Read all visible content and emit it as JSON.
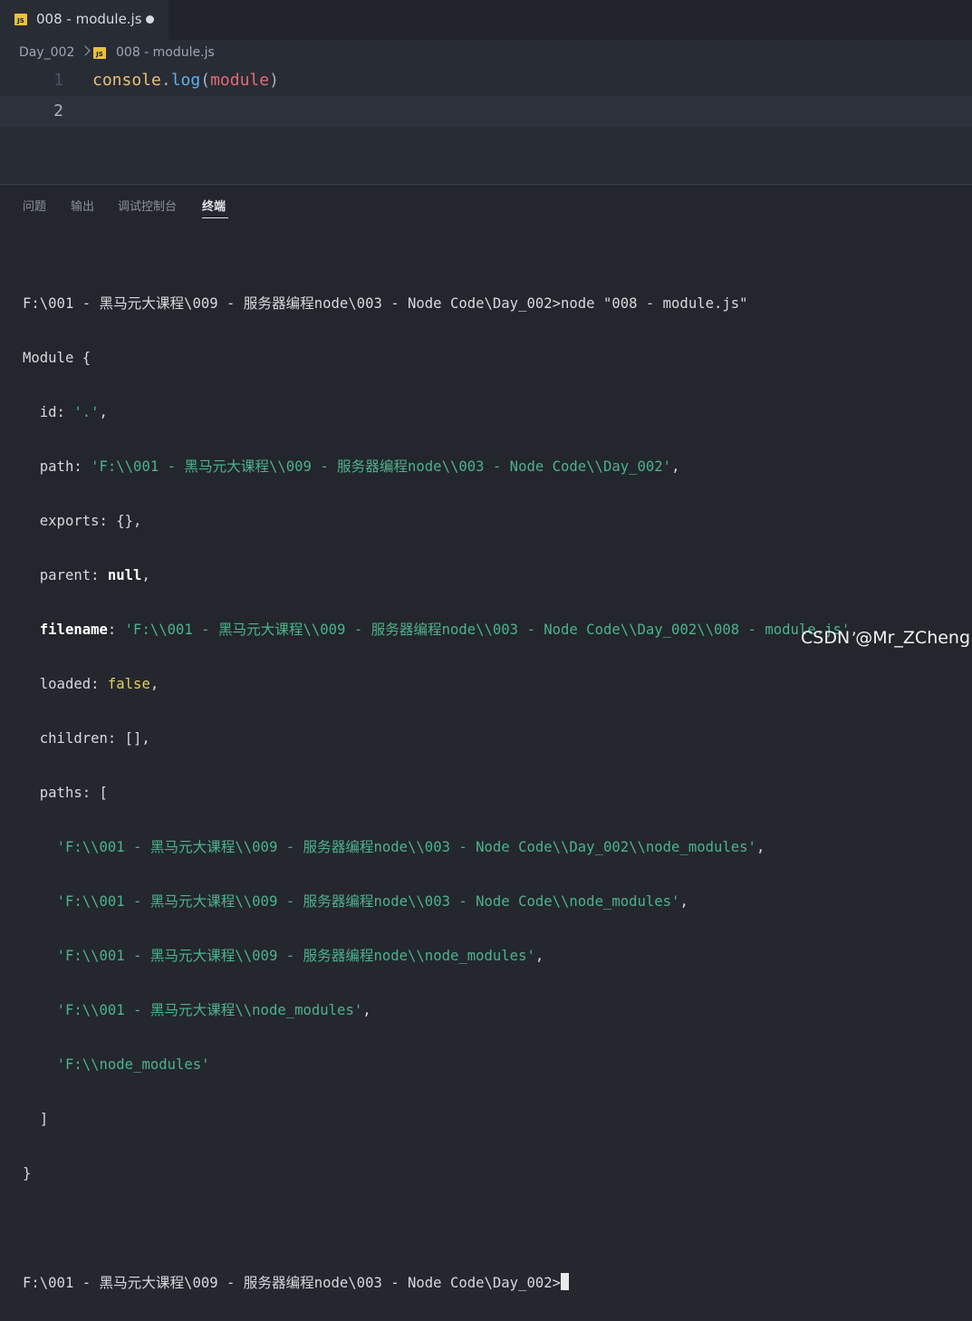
{
  "tab": {
    "label": "008 - module.js",
    "icon": "js-file-icon",
    "icon_text": "JS"
  },
  "breadcrumb": {
    "folder": "Day_002",
    "file": "008 - module.js"
  },
  "editor": {
    "lines": [
      {
        "number": "1",
        "tokens": {
          "obj": "console",
          "dot": ".",
          "fn": "log",
          "open": "(",
          "arg": "module",
          "close": ")"
        }
      },
      {
        "number": "2"
      }
    ]
  },
  "panel": {
    "tabs": [
      "问题",
      "输出",
      "调试控制台",
      "终端"
    ],
    "active_tab": "终端"
  },
  "terminal": {
    "command_line": "F:\\001 - 黑马元大课程\\009 - 服务器编程node\\003 - Node Code\\Day_002>node \"008 - module.js\"",
    "module_open": "Module {",
    "id_key": "  id: ",
    "id_val": "'.'",
    "id_tail": ",",
    "path_key": "  path: ",
    "path_val": "'F:\\\\001 - 黑马元大课程\\\\009 - 服务器编程node\\\\003 - Node Code\\\\Day_002'",
    "path_tail": ",",
    "exports_line": "  exports: {},",
    "parent_key": "  parent: ",
    "parent_val": "null",
    "parent_tail": ",",
    "filename_key": "  filename",
    "filename_colon": ": ",
    "filename_val": "'F:\\\\001 - 黑马元大课程\\\\009 - 服务器编程node\\\\003 - Node Code\\\\Day_002\\\\008 - module.js'",
    "filename_tail": ",",
    "loaded_key": "  loaded: ",
    "loaded_val": "false",
    "loaded_tail": ",",
    "children_line": "  children: [],",
    "paths_key": "  paths: [",
    "paths": [
      "'F:\\\\001 - 黑马元大课程\\\\009 - 服务器编程node\\\\003 - Node Code\\\\Day_002\\\\node_modules'",
      "'F:\\\\001 - 黑马元大课程\\\\009 - 服务器编程node\\\\003 - Node Code\\\\node_modules'",
      "'F:\\\\001 - 黑马元大课程\\\\009 - 服务器编程node\\\\node_modules'",
      "'F:\\\\001 - 黑马元大课程\\\\node_modules'",
      "'F:\\\\node_modules'"
    ],
    "paths_close": "  ]",
    "module_close": "}",
    "prompt": "F:\\001 - 黑马元大课程\\009 - 服务器编程node\\003 - Node Code\\Day_002>"
  },
  "watermark": "CSDN @Mr_ZCheng",
  "colors": {
    "string": "#4cb38b",
    "keyword": "#e3d159",
    "fn": "#61afef",
    "obj": "#e5c07b",
    "var": "#e06c75"
  }
}
